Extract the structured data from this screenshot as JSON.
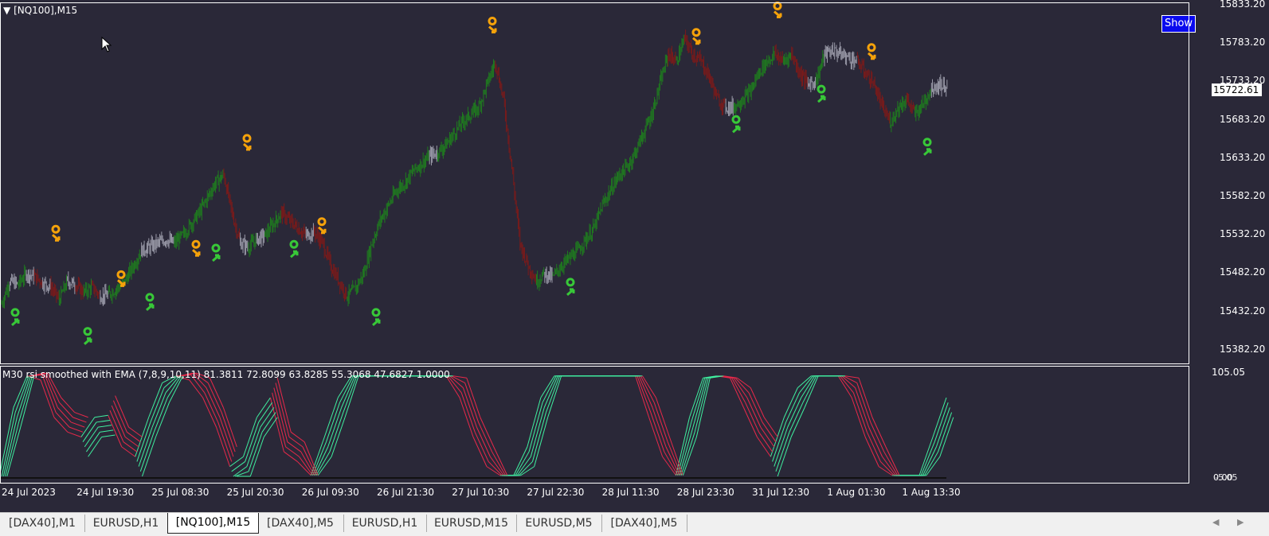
{
  "main_title": "[NQ100],M15",
  "indicator_title": "M30 rsi smoothed with EMA (7,8,9,10,11) 81.3811 72.8099 63.8285 55.3068 47.6827 1.0000",
  "show_button": "Show",
  "current_price": "15722.61",
  "price_ticks": [
    "15833.20",
    "15783.20",
    "15733.20",
    "15683.20",
    "15633.20",
    "15582.20",
    "15532.20",
    "15482.20",
    "15432.20",
    "15382.20"
  ],
  "indicator_ticks": [
    "105.05",
    "0.00"
  ],
  "indicator_tick_overlap": "-5.05",
  "time_labels": [
    "24 Jul 2023",
    "24 Jul 19:30",
    "25 Jul 08:30",
    "25 Jul 20:30",
    "26 Jul 09:30",
    "26 Jul 21:30",
    "27 Jul 10:30",
    "27 Jul 22:30",
    "28 Jul 11:30",
    "28 Jul 23:30",
    "31 Jul 12:30",
    "1 Aug 01:30",
    "1 Aug 13:30"
  ],
  "tabs": [
    {
      "label": "[DAX40],M1",
      "active": false
    },
    {
      "label": "EURUSD,H1",
      "active": false
    },
    {
      "label": "[NQ100],M15",
      "active": true
    },
    {
      "label": "[DAX40],M5",
      "active": false
    },
    {
      "label": "EURUSD,H1",
      "active": false
    },
    {
      "label": "EURUSD,M15",
      "active": false
    },
    {
      "label": "EURUSD,M5",
      "active": false
    },
    {
      "label": "[DAX40],M5",
      "active": false
    }
  ],
  "colors": {
    "background": "#2a2838",
    "bull": "#1f7a1f",
    "bear": "#7a1a1a",
    "neutral": "#9a9aa8",
    "rsi_up": "#3ff0a0",
    "rsi_down": "#e8284a",
    "sell_signal": "#f5a20a",
    "buy_signal": "#38c838"
  },
  "chart_data": {
    "type": "line",
    "price_range": [
      15360,
      15836
    ],
    "series": [
      {
        "name": "[NQ100],M15",
        "values": [
          15440,
          15470,
          15465,
          15480,
          15476,
          15468,
          15462,
          15445,
          15470,
          15465,
          15455,
          15462,
          15450,
          15452,
          15460,
          15470,
          15490,
          15510,
          15515,
          15520,
          15525,
          15520,
          15530,
          15545,
          15560,
          15580,
          15600,
          15610,
          15560,
          15520,
          15515,
          15525,
          15530,
          15545,
          15560,
          15550,
          15540,
          15530,
          15535,
          15520,
          15490,
          15470,
          15450,
          15460,
          15480,
          15520,
          15550,
          15570,
          15590,
          15600,
          15615,
          15625,
          15635,
          15640,
          15650,
          15665,
          15680,
          15690,
          15700,
          15730,
          15760,
          15710,
          15620,
          15520,
          15490,
          15470,
          15480,
          15475,
          15490,
          15500,
          15510,
          15525,
          15540,
          15570,
          15590,
          15610,
          15620,
          15640,
          15665,
          15690,
          15730,
          15770,
          15760,
          15790,
          15770,
          15760,
          15740,
          15710,
          15700,
          15700,
          15710,
          15720,
          15745,
          15760,
          15770,
          15760,
          15770,
          15745,
          15730,
          15735,
          15770,
          15775,
          15770,
          15765,
          15760,
          15745,
          15730,
          15700,
          15680,
          15700,
          15710,
          15690,
          15705,
          15725,
          15730,
          15725
        ]
      },
      {
        "name": "rsi_signal",
        "values": [
          3,
          70,
          102,
          98,
          60,
          45,
          40,
          60,
          62,
          30,
          20,
          60,
          95,
          102,
          98,
          80,
          50,
          10,
          20,
          60,
          80,
          25,
          15,
          1,
          40,
          80,
          102,
          102,
          102,
          102,
          102,
          102,
          102,
          102,
          80,
          40,
          10,
          1,
          1,
          30,
          80,
          102,
          102,
          102,
          102,
          102,
          102,
          102,
          60,
          20,
          1,
          60,
          100,
          102,
          100,
          70,
          40,
          20,
          60,
          90,
          102,
          102,
          102,
          80,
          40,
          10,
          1,
          1,
          1,
          40,
          80
        ]
      }
    ],
    "sell_markers": [
      [
        70,
        15530
      ],
      [
        152,
        15470
      ],
      [
        246,
        15510
      ],
      [
        310,
        15650
      ],
      [
        404,
        15540
      ],
      [
        618,
        15805
      ],
      [
        874,
        15790
      ],
      [
        976,
        15825
      ],
      [
        1094,
        15770
      ]
    ],
    "buy_markers": [
      [
        19,
        15420
      ],
      [
        110,
        15395
      ],
      [
        188,
        15440
      ],
      [
        271,
        15505
      ],
      [
        369,
        15510
      ],
      [
        472,
        15420
      ],
      [
        716,
        15460
      ],
      [
        924,
        15675
      ],
      [
        1031,
        15715
      ],
      [
        1164,
        15645
      ]
    ]
  }
}
